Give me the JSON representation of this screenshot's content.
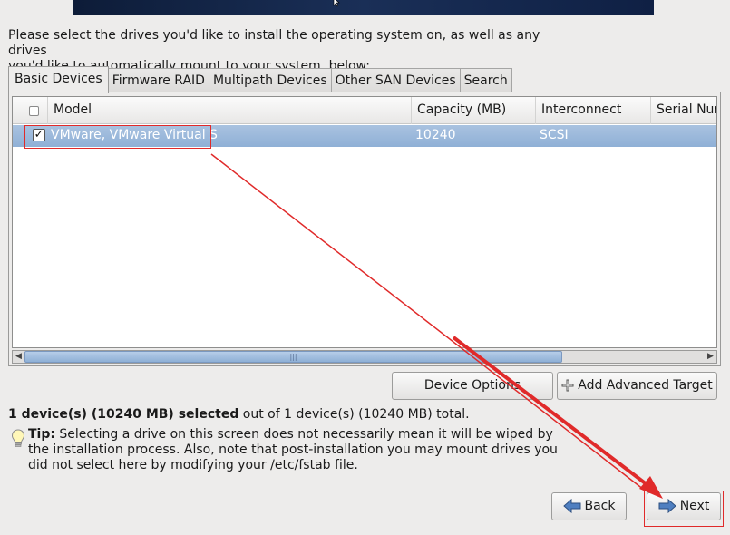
{
  "header": {
    "banner_color": "#0f2044"
  },
  "intro": {
    "line1": "Please select the drives you'd like to install the operating system on, as well as any drives",
    "line2": "you'd like to automatically mount to your system, below:"
  },
  "tabs": [
    {
      "label": "Basic Devices",
      "active": true
    },
    {
      "label": "Firmware RAID"
    },
    {
      "label": "Multipath Devices"
    },
    {
      "label": "Other SAN Devices"
    },
    {
      "label": "Search"
    }
  ],
  "table": {
    "columns": [
      "Model",
      "Capacity (MB)",
      "Interconnect",
      "Serial Num"
    ],
    "rows": [
      {
        "checked": true,
        "model": "VMware, VMware Virtual S",
        "capacity": "10240",
        "interconnect": "SCSI",
        "serial": ""
      }
    ],
    "selection_color": "#9ab7db",
    "scroll_grip": "|||"
  },
  "buttons": {
    "device_options": "Device Options",
    "add_target": "Add Advanced Target",
    "back": "Back",
    "next": "Next"
  },
  "summary": {
    "bold": "1 device(s) (10240 MB) selected",
    "rest": " out of 1 device(s) (10240 MB) total."
  },
  "tip": {
    "label": "Tip:",
    "text": " Selecting a drive on this screen does not necessarily mean it will be wiped by the installation process.  Also, note that post-installation you may mount drives you did not select here by modifying your /etc/fstab file."
  },
  "annotation_color": "#e02a2a"
}
